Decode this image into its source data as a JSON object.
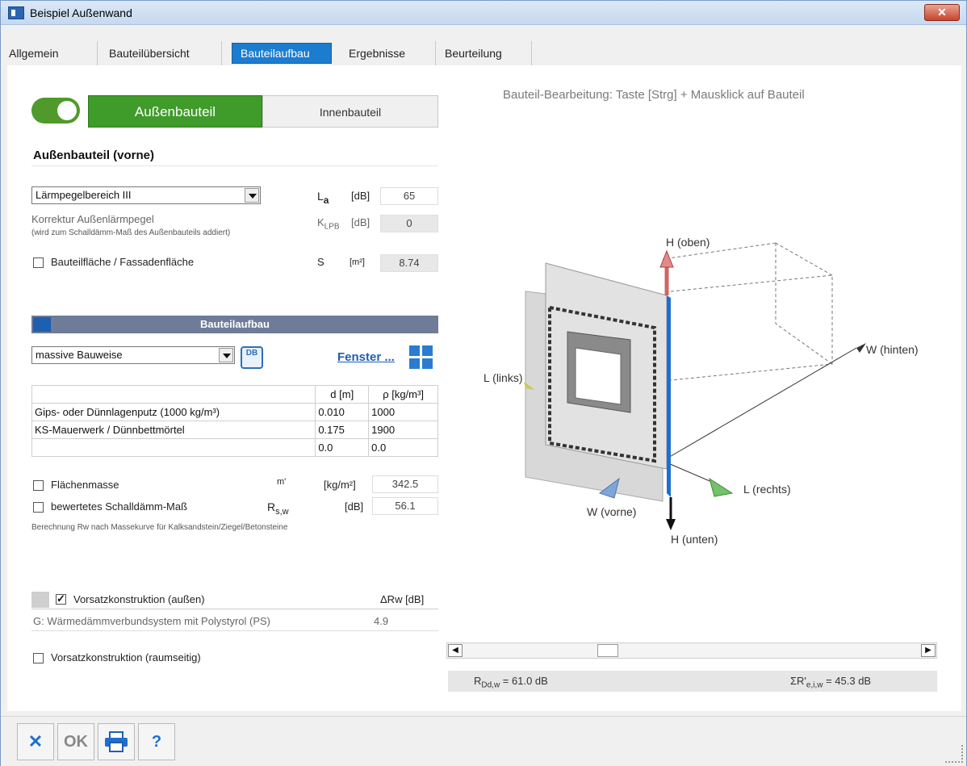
{
  "window": {
    "title": "Beispiel Außenwand",
    "close": "✕"
  },
  "tabs": [
    "Allgemein",
    "Bauteilübersicht",
    "Bauteilaufbau",
    "Ergebnisse",
    "Beurteilung"
  ],
  "toggle": {
    "on_label": "Außenbauteil",
    "off_label": "Innenbauteil"
  },
  "outer": {
    "heading": "Außenbauteil (vorne)",
    "noise_range": "Lärmpegelbereich III",
    "la_symbol": "L",
    "la_sub": "a",
    "la_unit": "[dB]",
    "la_value": "65",
    "corr_label": "Korrektur Außenlärmpegel",
    "corr_note": "(wird zum Schalldämm-Maß des Außenbauteils addiert)",
    "klpb_symbol": "K",
    "klpb_sub": "LPB",
    "klpb_unit": "[dB]",
    "klpb_value": "0",
    "area_label": "Bauteilfläche / Fassadenfläche",
    "area_symbol": "S",
    "area_unit": "[m²]",
    "area_value": "8.74"
  },
  "build": {
    "band": "Bauteilaufbau",
    "type": "massive Bauweise",
    "db_icon": "DB",
    "window_link": "Fenster ...",
    "col_d": "d [m]",
    "col_rho": "ρ [kg/m³]",
    "rows": [
      {
        "name": "Gips- oder Dünnlagenputz (1000 kg/m³)",
        "d": "0.010",
        "rho": "1000"
      },
      {
        "name": "KS-Mauerwerk / Dünnbettmörtel",
        "d": "0.175",
        "rho": "1900"
      },
      {
        "name": "",
        "d": "0.0",
        "rho": "0.0"
      }
    ],
    "mass_label": "Flächenmasse",
    "mass_symbol": "m'",
    "mass_unit": "[kg/m²]",
    "mass_value": "342.5",
    "rw_label": "bewertetes Schalldämm-Maß",
    "rw_symbol": "R",
    "rw_sub": "s,w",
    "rw_unit": "[dB]",
    "rw_value": "56.1",
    "note": "Berechnung Rw nach Massekurve für Kalksandstein/Ziegel/Betonsteine"
  },
  "vorsatz": {
    "outer_label": "Vorsatzkonstruktion (außen)",
    "delta_header": "ΔRw [dB]",
    "outer_item": "G: Wärmedämmverbundsystem mit Polystyrol (PS)",
    "outer_value": "4.9",
    "inner_label": "Vorsatzkonstruktion (raumseitig)"
  },
  "view": {
    "hint": "Bauteil-Bearbeitung: Taste [Strg] + Mausklick auf Bauteil",
    "h_top": "H (oben)",
    "h_bottom": "H (unten)",
    "w_back": "W (hinten)",
    "w_front": "W (vorne)",
    "l_left": "L (links)",
    "l_right": "L (rechts)"
  },
  "status": {
    "left_main": "R",
    "left_sub": "Dd,w",
    "left_value": " = 61.0 dB",
    "right_main": "ΣR'",
    "right_sub": "e,i,w",
    "right_value": " = 45.3 dB"
  },
  "buttons": {
    "cancel": "✕",
    "ok": "OK",
    "help": "?"
  }
}
